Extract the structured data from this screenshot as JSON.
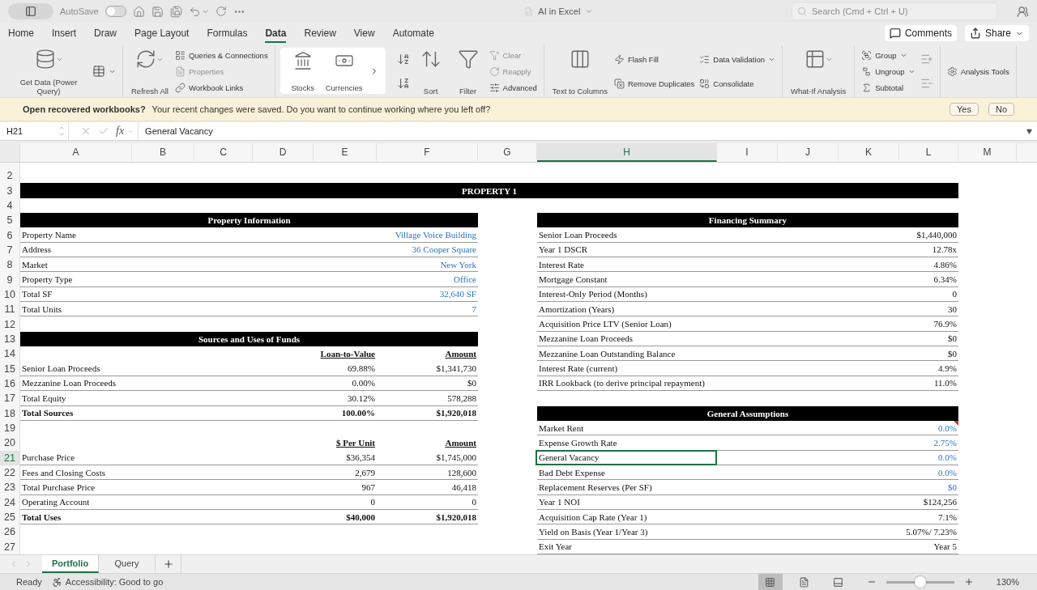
{
  "title_bar": {
    "autosave_label": "AutoSave",
    "autosave_on": false,
    "document_title": "AI in Excel",
    "search_placeholder": "Search (Cmd + Ctrl + U)"
  },
  "ribbon_tabs": [
    {
      "label": "Home",
      "selected": false
    },
    {
      "label": "Insert",
      "selected": false
    },
    {
      "label": "Draw",
      "selected": false
    },
    {
      "label": "Page Layout",
      "selected": false
    },
    {
      "label": "Formulas",
      "selected": false
    },
    {
      "label": "Data",
      "selected": true
    },
    {
      "label": "Review",
      "selected": false
    },
    {
      "label": "View",
      "selected": false
    },
    {
      "label": "Automate",
      "selected": false
    }
  ],
  "actions": {
    "comments": "Comments",
    "share": "Share"
  },
  "ribbon": {
    "groups": [
      {
        "kind": "plain",
        "columns": [
          {
            "kind": "large",
            "label": "Get Data (Power Query)",
            "caret": true
          },
          {
            "kind": "stack",
            "items": [
              {
                "kind": "icon",
                "caret": true,
                "disabled": false
              }
            ]
          }
        ]
      },
      {
        "kind": "plain",
        "columns": [
          {
            "kind": "large",
            "label": "Refresh All",
            "caret": true
          },
          {
            "kind": "stack",
            "items": [
              {
                "kind": "text",
                "label": "Queries & Connections",
                "disabled": false,
                "caret": false
              },
              {
                "kind": "text",
                "label": "Properties",
                "disabled": true,
                "caret": false
              },
              {
                "kind": "text",
                "label": "Workbook Links",
                "disabled": false,
                "caret": false
              }
            ]
          }
        ]
      },
      {
        "kind": "gallery",
        "columns": [
          {
            "kind": "large",
            "label": "Stocks",
            "caret": false
          },
          {
            "kind": "large",
            "label": "Currencies",
            "caret": false
          }
        ]
      },
      {
        "kind": "plain",
        "columns": [
          {
            "kind": "stack",
            "items": [
              {
                "kind": "icon",
                "caret": false,
                "disabled": false
              },
              {
                "kind": "icon",
                "caret": false,
                "disabled": false
              }
            ]
          },
          {
            "kind": "large",
            "label": "Sort",
            "caret": false
          },
          {
            "kind": "large",
            "label": "Filter",
            "caret": false
          },
          {
            "kind": "stack",
            "items": [
              {
                "kind": "text",
                "label": "Clear",
                "disabled": true,
                "caret": false
              },
              {
                "kind": "text",
                "label": "Reapply",
                "disabled": true,
                "caret": false
              },
              {
                "kind": "text",
                "label": "Advanced",
                "disabled": false,
                "caret": false
              }
            ]
          }
        ]
      },
      {
        "kind": "plain",
        "columns": [
          {
            "kind": "large",
            "label": "Text to Columns",
            "caret": false
          },
          {
            "kind": "stack",
            "items": [
              {
                "kind": "text",
                "label": "Flash Fill",
                "disabled": false,
                "caret": false
              },
              {
                "kind": "text",
                "label": "Remove Duplicates",
                "disabled": false,
                "caret": false
              }
            ]
          },
          {
            "kind": "stack",
            "items": [
              {
                "kind": "text",
                "label": "Data Validation",
                "disabled": false,
                "caret": true
              },
              {
                "kind": "text",
                "label": "Consolidate",
                "disabled": false,
                "caret": false
              }
            ]
          }
        ]
      },
      {
        "kind": "plain",
        "columns": [
          {
            "kind": "large",
            "label": "What-If Analysis",
            "caret": true
          }
        ]
      },
      {
        "kind": "plain",
        "columns": [
          {
            "kind": "stack",
            "items": [
              {
                "kind": "text",
                "label": "Group",
                "disabled": false,
                "caret": true
              },
              {
                "kind": "text",
                "label": "Ungroup",
                "disabled": false,
                "caret": true
              },
              {
                "kind": "text",
                "label": "Subtotal",
                "disabled": false,
                "caret": false
              }
            ]
          },
          {
            "kind": "stack",
            "items": [
              {
                "kind": "icon",
                "caret": false,
                "disabled": true
              },
              {
                "kind": "icon",
                "caret": false,
                "disabled": true
              }
            ]
          }
        ]
      },
      {
        "kind": "plain",
        "columns": [
          {
            "kind": "stack",
            "items": [
              {
                "kind": "text",
                "label": "Analysis Tools",
                "disabled": false,
                "caret": false
              }
            ]
          }
        ]
      }
    ]
  },
  "message_bar": {
    "title": "Open recovered workbooks?",
    "text": "Your recent changes were saved. Do you want to continue working where you left off?",
    "buttons": [
      "Yes",
      "No"
    ]
  },
  "formula_bar": {
    "name_box": "H21",
    "function_label": "fx",
    "value": "General Vacancy"
  },
  "sheet": {
    "columns": [
      {
        "letter": "A",
        "selected": false
      },
      {
        "letter": "B",
        "selected": false
      },
      {
        "letter": "C",
        "selected": false
      },
      {
        "letter": "D",
        "selected": false
      },
      {
        "letter": "E",
        "selected": false
      },
      {
        "letter": "F",
        "selected": false
      },
      {
        "letter": "G",
        "selected": false
      },
      {
        "letter": "H",
        "selected": true
      },
      {
        "letter": "I",
        "selected": false
      },
      {
        "letter": "J",
        "selected": false
      },
      {
        "letter": "K",
        "selected": false
      },
      {
        "letter": "L",
        "selected": false
      },
      {
        "letter": "M",
        "selected": false
      }
    ],
    "rows": [
      {
        "number": "2",
        "selected": false
      },
      {
        "number": "3",
        "selected": false,
        "banner": "PROPERTY 1"
      },
      {
        "number": "4",
        "selected": false
      },
      {
        "number": "5",
        "selected": false,
        "left": {
          "kind": "header",
          "text": "Property Information"
        },
        "right": {
          "kind": "header",
          "text": "Financing Summary"
        }
      },
      {
        "number": "6",
        "selected": false,
        "left": {
          "kind": "field",
          "label": "Property Name",
          "value": "Village Voice Building",
          "input": true
        },
        "right": {
          "kind": "field",
          "label": "Senior Loan Proceeds",
          "value": "$1,440,000",
          "input": false,
          "comment": false
        }
      },
      {
        "number": "7",
        "selected": false,
        "left": {
          "kind": "field",
          "label": "Address",
          "value": "36 Cooper Square",
          "input": true
        },
        "right": {
          "kind": "field",
          "label": "Year 1 DSCR",
          "value": "12.78x",
          "input": false,
          "comment": false
        }
      },
      {
        "number": "8",
        "selected": false,
        "left": {
          "kind": "field",
          "label": "Market",
          "value": "New York",
          "input": true
        },
        "right": {
          "kind": "field",
          "label": "Interest Rate",
          "value": "4.86%",
          "input": false,
          "comment": false
        }
      },
      {
        "number": "9",
        "selected": false,
        "left": {
          "kind": "field",
          "label": "Property Type",
          "value": "Office",
          "input": true
        },
        "right": {
          "kind": "field",
          "label": "Mortgage Constant",
          "value": "6.34%",
          "input": false,
          "comment": false
        }
      },
      {
        "number": "10",
        "selected": false,
        "left": {
          "kind": "field",
          "label": "Total SF",
          "value": "32,640 SF",
          "input": true
        },
        "right": {
          "kind": "field",
          "label": "Interest-Only Period (Months)",
          "value": "0",
          "input": false,
          "comment": false
        }
      },
      {
        "number": "11",
        "selected": false,
        "left": {
          "kind": "field",
          "label": "Total Units",
          "value": "7",
          "input": true
        },
        "right": {
          "kind": "field",
          "label": "Amortization (Years)",
          "value": "30",
          "input": false,
          "comment": false
        }
      },
      {
        "number": "12",
        "selected": false,
        "right": {
          "kind": "field",
          "label": "Acquisition Price LTV (Senior Loan)",
          "value": "76.9%",
          "input": false,
          "comment": false
        }
      },
      {
        "number": "13",
        "selected": false,
        "left": {
          "kind": "header",
          "text": "Sources and Uses of Funds"
        },
        "right": {
          "kind": "field",
          "label": "Mezzanine Loan Proceeds",
          "value": "$0",
          "input": false,
          "comment": false
        }
      },
      {
        "number": "14",
        "selected": false,
        "left": {
          "kind": "colheads",
          "c1": "Loan-to-Value",
          "c2": "Amount"
        },
        "right": {
          "kind": "field",
          "label": "Mezzanine Loan Outstanding Balance",
          "value": "$0",
          "input": false,
          "comment": false
        }
      },
      {
        "number": "15",
        "selected": false,
        "left": {
          "kind": "amounts",
          "label": "Senior Loan Proceeds",
          "c1": "69.88%",
          "c2": "$1,341,730",
          "bold": false
        },
        "right": {
          "kind": "field",
          "label": "Interest Rate (current)",
          "value": "4.9%",
          "input": false,
          "comment": false
        }
      },
      {
        "number": "16",
        "selected": false,
        "left": {
          "kind": "amounts",
          "label": "Mezzanine Loan Proceeds",
          "c1": "0.00%",
          "c2": "$0",
          "bold": false
        },
        "right": {
          "kind": "field",
          "label": "IRR Lookback (to derive principal repayment)",
          "value": "11.0%",
          "input": false,
          "comment": false
        }
      },
      {
        "number": "17",
        "selected": false,
        "left": {
          "kind": "amounts",
          "label": "Total Equity",
          "c1": "30.12%",
          "c2": "578,288",
          "bold": false
        }
      },
      {
        "number": "18",
        "selected": false,
        "left": {
          "kind": "amounts",
          "label": "Total Sources",
          "c1": "100.00%",
          "c2": "$1,920,018",
          "bold": true
        },
        "right": {
          "kind": "header",
          "text": "General Assumptions"
        }
      },
      {
        "number": "19",
        "selected": false,
        "right": {
          "kind": "field",
          "label": "Market Rent",
          "value": "0.0%",
          "input": true,
          "comment": true
        }
      },
      {
        "number": "20",
        "selected": false,
        "left": {
          "kind": "colheads",
          "c1": "$ Per Unit",
          "c2": "Amount"
        },
        "right": {
          "kind": "field",
          "label": "Expense Growth Rate",
          "value": "2.75%",
          "input": true,
          "comment": false
        }
      },
      {
        "number": "21",
        "selected": true,
        "left": {
          "kind": "amounts",
          "label": "Purchase Price",
          "c1": "$36,354",
          "c2": "$1,745,000",
          "bold": false
        },
        "right": {
          "kind": "field",
          "label": "General Vacancy",
          "value": "0.0%",
          "input": true,
          "comment": false
        }
      },
      {
        "number": "22",
        "selected": false,
        "left": {
          "kind": "amounts",
          "label": "Fees and Closing Costs",
          "c1": "2,679",
          "c2": "128,600",
          "bold": false
        },
        "right": {
          "kind": "field",
          "label": "Bad Debt Expense",
          "value": "0.0%",
          "input": true,
          "comment": false
        }
      },
      {
        "number": "23",
        "selected": false,
        "left": {
          "kind": "amounts",
          "label": "Total Purchase Price",
          "c1": "967",
          "c2": "46,418",
          "bold": false
        },
        "right": {
          "kind": "field",
          "label": "Replacement Reserves (Per SF)",
          "value": "$0",
          "input": true,
          "comment": false
        }
      },
      {
        "number": "24",
        "selected": false,
        "left": {
          "kind": "amounts",
          "label": "Operating Account",
          "c1": "0",
          "c2": "0",
          "bold": false
        },
        "right": {
          "kind": "field",
          "label": "Year 1 NOI",
          "value": "$124,256",
          "input": false,
          "comment": false
        }
      },
      {
        "number": "25",
        "selected": false,
        "left": {
          "kind": "amounts",
          "label": "Total Uses",
          "c1": "$40,000",
          "c2": "$1,920,018",
          "bold": true
        },
        "right": {
          "kind": "field",
          "label": "Acquisition Cap Rate (Year 1)",
          "value": "7.1%",
          "input": false,
          "comment": false
        }
      },
      {
        "number": "26",
        "selected": false,
        "right": {
          "kind": "field",
          "label": "Yield on Basis  (Year 1/Year 3)",
          "value": "5.07%/ 7.23%",
          "input": false,
          "comment": false
        }
      },
      {
        "number": "27",
        "selected": false,
        "right": {
          "kind": "field",
          "label": "Exit Year",
          "value": "Year 5",
          "input": false,
          "comment": false
        }
      }
    ]
  },
  "sheet_tabs": [
    {
      "label": "Portfolio",
      "selected": true
    },
    {
      "label": "Query",
      "selected": false
    }
  ],
  "status_bar": {
    "status": "Ready",
    "accessibility": "Accessibility: Good to go",
    "views": [
      {
        "selected": true
      },
      {
        "selected": false
      },
      {
        "selected": false
      }
    ],
    "zoom": {
      "level": 0.5,
      "reading": "130%"
    }
  }
}
